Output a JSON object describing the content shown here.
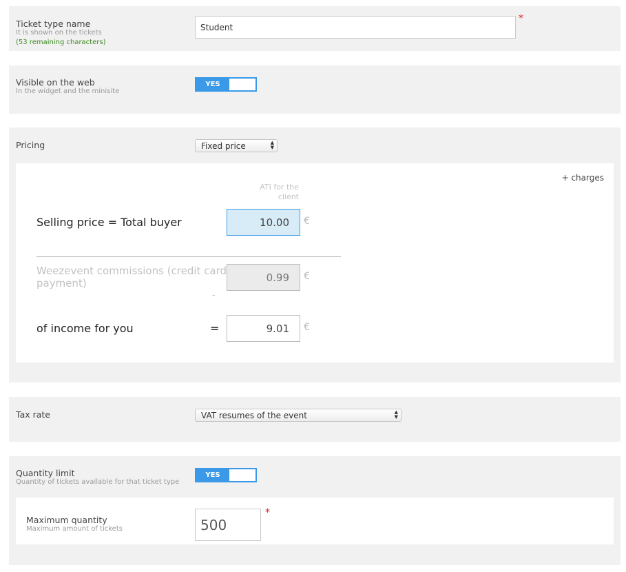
{
  "ticket_name": {
    "label": "Ticket type name",
    "sublabel": "It is shown on the tickets",
    "remaining": "(53 remaining characters)",
    "value": "Student",
    "required": "*"
  },
  "visible_web": {
    "label": "Visible on the web",
    "sublabel": "In the widget and the minisite",
    "toggle": "YES"
  },
  "pricing": {
    "label": "Pricing",
    "select_value": "Fixed price",
    "charges_link": "+ charges",
    "column_header_line1": "ATI for the",
    "column_header_line2": "client",
    "selling_label": "Selling price = Total buyer",
    "selling_value": "10.00",
    "commission_label_line1": "Weezevent commissions (credit card",
    "commission_label_line2": "payment)",
    "commission_value": "0.99",
    "minus": "-",
    "income_label": "of income for you",
    "equals": "=",
    "income_value": "9.01",
    "currency": "€"
  },
  "tax_rate": {
    "label": "Tax rate",
    "select_value": "VAT resumes of the event"
  },
  "quantity_limit": {
    "label": "Quantity limit",
    "sublabel": "Quantity of tickets available for that ticket type",
    "toggle": "YES",
    "max_label": "Maximum quantity",
    "max_sublabel": "Maximum amount of tickets",
    "max_value": "500",
    "required": "*"
  },
  "colors": {
    "accent": "#3a9ae8",
    "highlight_input": "#d8ecf8",
    "required": "#d01c1c",
    "remaining_text": "#3c8a1e"
  }
}
